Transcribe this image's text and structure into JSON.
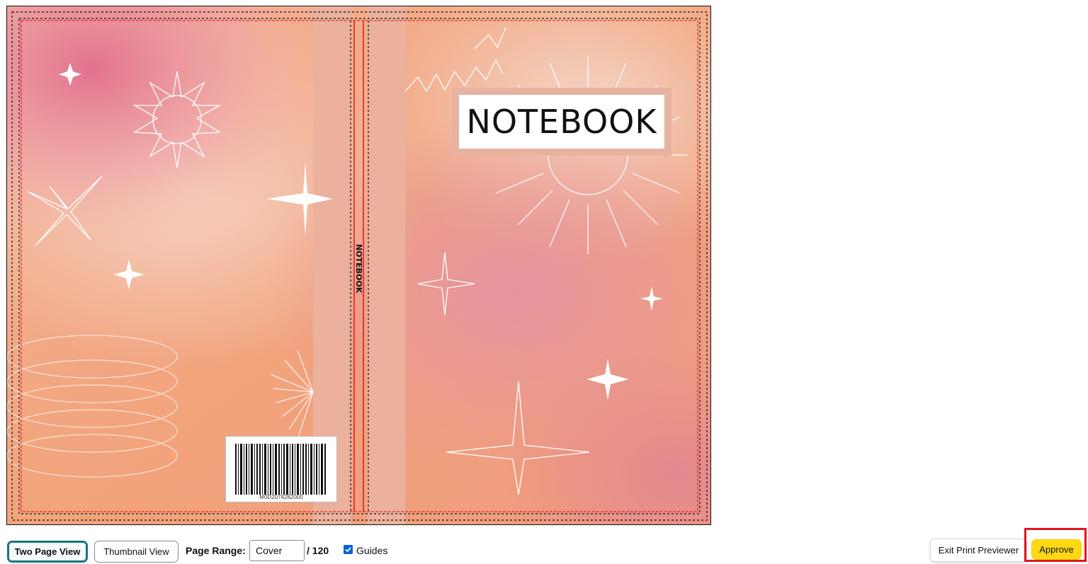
{
  "cover": {
    "title": "NOTEBOOK",
    "spine_title": "NOTEBOOK",
    "barcode_number": "M0D2074282000",
    "colors": {
      "background_peach": "#f2a77e",
      "pink_glow": "#e07b93",
      "spine_band": "#ebb19c",
      "bleed_guide": "#e01010",
      "safe_guide": "#111111"
    }
  },
  "toolbar": {
    "two_page_view": "Two Page View",
    "thumbnail_view": "Thumbnail View",
    "page_range_label": "Page Range:",
    "page_range_value": "Cover",
    "page_total": "/ 120",
    "guides_label": "Guides",
    "guides_checked": true,
    "exit_label": "Exit Print Previewer",
    "approve_label": "Approve"
  }
}
